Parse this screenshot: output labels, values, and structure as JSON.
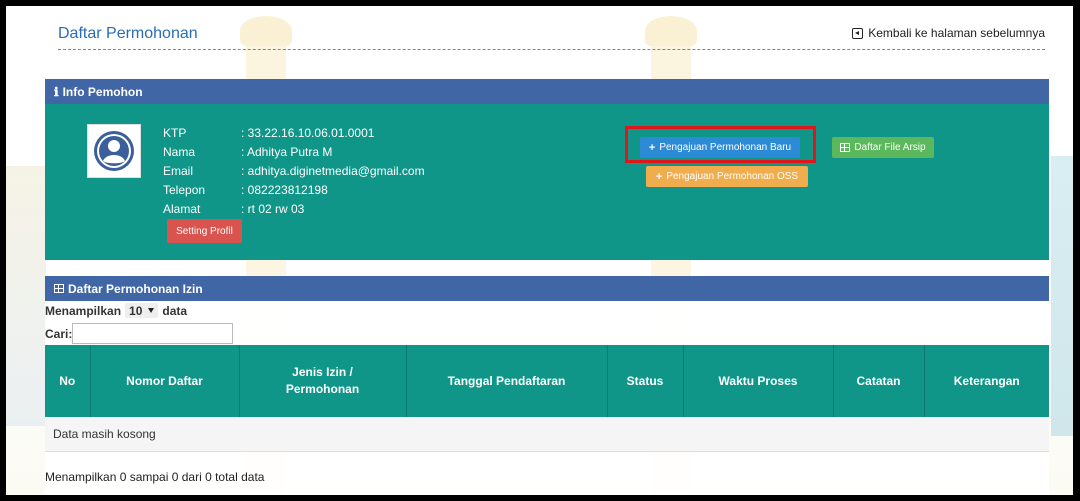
{
  "header": {
    "title": "Daftar Permohonan",
    "back_label": "Kembali ke halaman sebelumnya"
  },
  "info_panel": {
    "title": "Info Pemohon",
    "fields": [
      {
        "label": "KTP",
        "value": ": 33.22.16.10.06.01.0001"
      },
      {
        "label": "Nama",
        "value": ": Adhitya Putra M"
      },
      {
        "label": "Email",
        "value": ": adhitya.diginetmedia@gmail.com"
      },
      {
        "label": "Telepon",
        "value": ": 082223812198"
      },
      {
        "label": "Alamat",
        "value": ": rt 02 rw 03"
      }
    ],
    "setting_label": "Setting Profil",
    "btn_baru_label": "Pengajuan Permohonan Baru",
    "btn_oss_label": "Pengajuan Permohonan OSS",
    "btn_arsip_label": "Daftar File Arsip"
  },
  "list_panel": {
    "title": "Daftar Permohonan Izin",
    "show_prefix": "Menampilkan",
    "page_size": "10",
    "show_suffix": "data",
    "search_label": "Cari:",
    "search_value": "",
    "columns": [
      "No",
      "Nomor Daftar",
      "Jenis Izin /\nPermohonan",
      "Tanggal Pendaftaran",
      "Status",
      "Waktu Proses",
      "Catatan",
      "Keterangan"
    ],
    "empty_text": "Data masih kosong",
    "footer": "Menampilkan 0 sampai 0 dari 0 total data"
  },
  "colors": {
    "panel_header": "#4066a6",
    "teal": "#109688",
    "danger": "#d9534f",
    "primary": "#2b8bd6",
    "warning": "#f0ad4e",
    "success": "#5cb85c",
    "highlight": "#e0161b"
  },
  "icons": {
    "info": "info-icon",
    "grid": "grid-icon",
    "plus": "plus-icon",
    "back": "back-square-icon",
    "avatar": "user-avatar-icon"
  }
}
